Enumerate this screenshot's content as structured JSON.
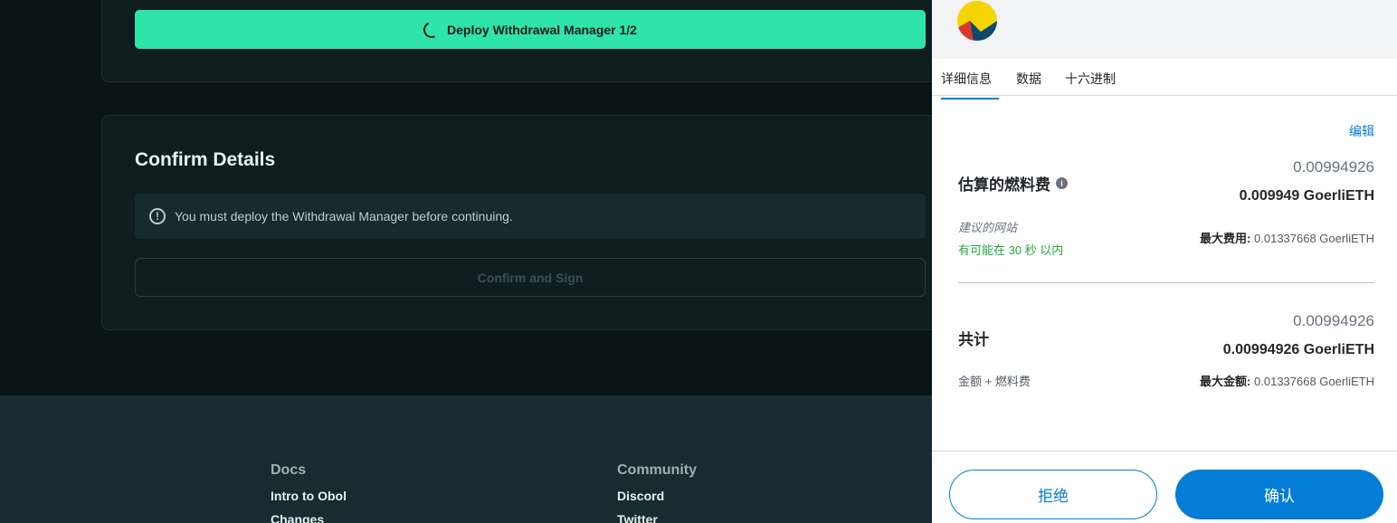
{
  "app": {
    "deploy_button_label": "Deploy Withdrawal Manager 1/2",
    "confirm_title": "Confirm Details",
    "alert_text": "You must deploy the Withdrawal Manager before continuing.",
    "confirm_sign_label": "Confirm and Sign",
    "footer": {
      "docs_heading": "Docs",
      "docs_links": [
        "Intro to Obol",
        "Changes"
      ],
      "community_heading": "Community",
      "community_links": [
        "Discord",
        "Twitter"
      ]
    },
    "colors": {
      "accent": "#2fe4ab",
      "background": "#0a1315",
      "card": "#0f1d20",
      "footer": "#182b30"
    }
  },
  "wallet": {
    "tabs": [
      "详细信息",
      "数据",
      "十六进制"
    ],
    "active_tab": "详细信息",
    "edit_label": "编辑",
    "gas": {
      "label": "估算的燃料费",
      "secondary_amount": "0.00994926",
      "primary_amount": "0.009949 GoerliETH",
      "site_suggested": "建议的网站",
      "time_estimate": "有可能在 30 秒 以内",
      "max_fee_label": "最大费用:",
      "max_fee_value": "0.01337668 GoerliETH"
    },
    "total": {
      "label": "共计",
      "secondary_amount": "0.00994926",
      "primary_amount": "0.00994926 GoerliETH",
      "sub_label": "金额 + 燃料费",
      "max_amount_label": "最大金额:",
      "max_amount_value": "0.01337668 GoerliETH"
    },
    "reject_label": "拒绝",
    "confirm_label": "确认",
    "colors": {
      "primary": "#037dd6",
      "success": "#28a745"
    }
  }
}
